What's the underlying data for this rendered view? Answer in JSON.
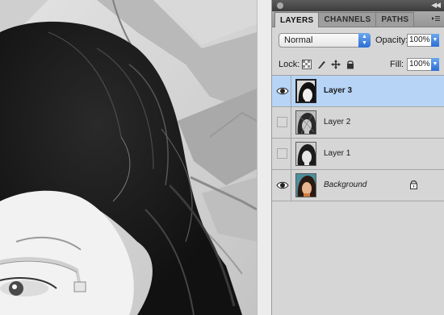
{
  "panel": {
    "tabs": [
      {
        "label": "LAYERS",
        "active": true
      },
      {
        "label": "CHANNELS",
        "active": false
      },
      {
        "label": "PATHS",
        "active": false
      }
    ],
    "blend_mode": "Normal",
    "opacity_label": "Opacity:",
    "opacity_value": "100%",
    "lock_label": "Lock:",
    "fill_label": "Fill:",
    "fill_value": "100%",
    "menu_icon": "panel-menu-icon",
    "lock_icons": [
      "lock-transparent-pixels-icon",
      "lock-image-pixels-icon",
      "lock-position-icon",
      "lock-all-icon"
    ]
  },
  "layers": [
    {
      "name": "Layer 3",
      "visible": true,
      "selected": true,
      "italic": false,
      "locked": false,
      "thumb": "bw"
    },
    {
      "name": "Layer 2",
      "visible": false,
      "selected": false,
      "italic": false,
      "locked": false,
      "thumb": "bw-noisy"
    },
    {
      "name": "Layer 1",
      "visible": false,
      "selected": false,
      "italic": false,
      "locked": false,
      "thumb": "bw"
    },
    {
      "name": "Background",
      "visible": true,
      "selected": false,
      "italic": true,
      "locked": true,
      "thumb": "color"
    }
  ],
  "colors": {
    "selection": "#b7d4f6",
    "panel_bg": "#d6d6d6",
    "aqua_accent": "#2c6fd6"
  }
}
